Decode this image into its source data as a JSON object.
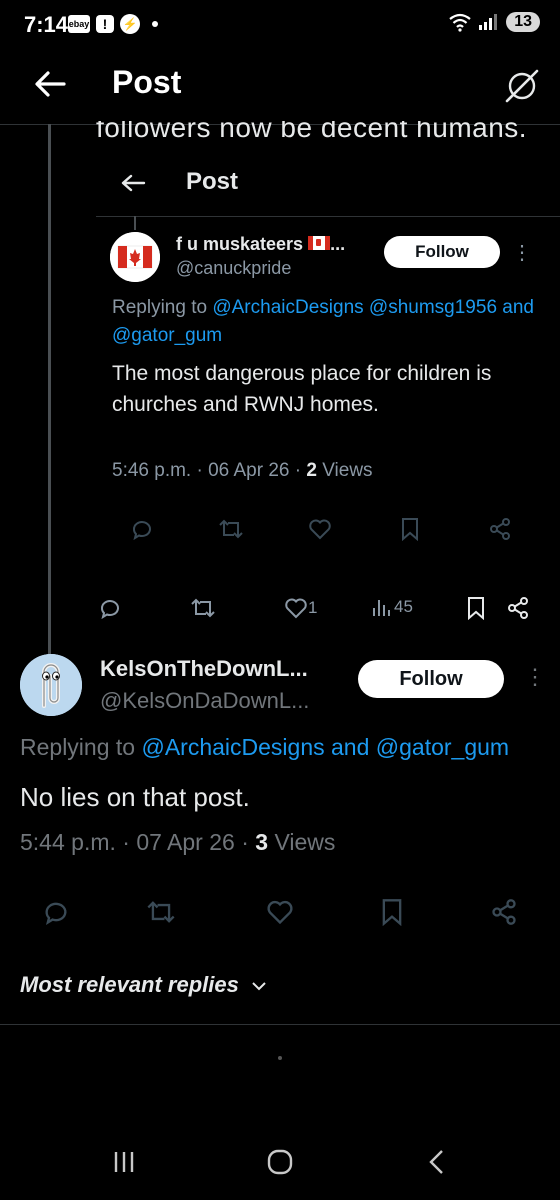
{
  "status_bar": {
    "time": "7:14",
    "ebay_label": "ebay",
    "battery": "13"
  },
  "header": {
    "title": "Post"
  },
  "quoted_screenshot": {
    "cut_off_text": "followers now be decent humans.",
    "header_title": "Post",
    "author_name": "f u muskateers",
    "author_handle": "@canuckpride",
    "follow_label": "Follow",
    "replying_prefix": "Replying to",
    "replying_to_1": "@ArchaicDesigns",
    "replying_to_2": "@shumsg1956",
    "replying_and": "and",
    "replying_to_3": "@gator_gum",
    "body": "The most dangerous place for children is churches and RWNJ homes.",
    "time": "5:46 p.m.",
    "date": "06 Apr 26",
    "views_count": "2",
    "views_label": "Views"
  },
  "parent_actions": {
    "likes": "1",
    "views": "45"
  },
  "reply_tweet": {
    "author_name": "KelsOnTheDownL...",
    "author_handle": "@KelsOnDaDownL...",
    "follow_label": "Follow",
    "replying_prefix": "Replying to",
    "replying_to": "@ArchaicDesigns and @gator_gum",
    "body": "No lies on that post.",
    "time": "5:44 p.m.",
    "date": "07 Apr 26",
    "views_count": "3",
    "views_label": "Views"
  },
  "replies_sort": {
    "label": "Most relevant replies"
  },
  "colors": {
    "background": "#000000",
    "link": "#1d9bf0",
    "muted": "#71767b"
  }
}
